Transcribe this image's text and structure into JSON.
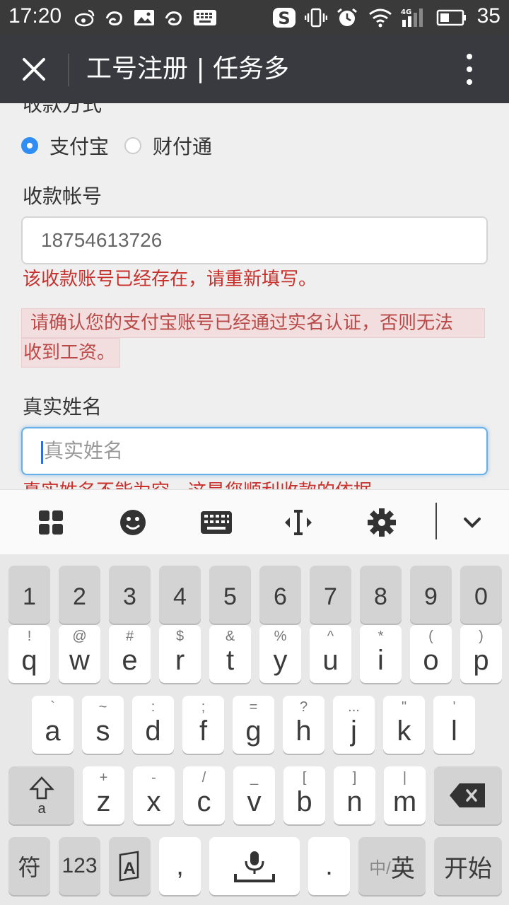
{
  "status_bar": {
    "time": "17:20",
    "battery": "35"
  },
  "title_bar": {
    "title": "工号注册 | 任务多"
  },
  "form": {
    "cut_label": "收款方式",
    "payment_options": [
      {
        "label": "支付宝",
        "checked": true
      },
      {
        "label": "财付通",
        "checked": false
      }
    ],
    "account_label": "收款帐号",
    "account_value": "18754613726",
    "account_error": "该收款账号已经存在，请重新填写。",
    "alert_line1": "请确认您的支付宝账号已经通过实名认证，否则无法",
    "alert_line2": "收到工资。",
    "name_label": "真实姓名",
    "name_placeholder": "真实姓名",
    "name_error": "真实姓名不能为空，这是您顺利收款的依据"
  },
  "keyboard": {
    "numbers": [
      "1",
      "2",
      "3",
      "4",
      "5",
      "6",
      "7",
      "8",
      "9",
      "0"
    ],
    "row1": [
      {
        "k": "q",
        "s": "!"
      },
      {
        "k": "w",
        "s": "@"
      },
      {
        "k": "e",
        "s": "#"
      },
      {
        "k": "r",
        "s": "$"
      },
      {
        "k": "t",
        "s": "&"
      },
      {
        "k": "y",
        "s": "%"
      },
      {
        "k": "u",
        "s": "^"
      },
      {
        "k": "i",
        "s": "*"
      },
      {
        "k": "o",
        "s": "("
      },
      {
        "k": "p",
        "s": ")"
      }
    ],
    "row2": [
      {
        "k": "a",
        "s": "`"
      },
      {
        "k": "s",
        "s": "~"
      },
      {
        "k": "d",
        "s": ":"
      },
      {
        "k": "f",
        "s": ";"
      },
      {
        "k": "g",
        "s": "="
      },
      {
        "k": "h",
        "s": "?"
      },
      {
        "k": "j",
        "s": "..."
      },
      {
        "k": "k",
        "s": "\""
      },
      {
        "k": "l",
        "s": "'"
      }
    ],
    "row3": [
      {
        "k": "z",
        "s": "+"
      },
      {
        "k": "x",
        "s": "-"
      },
      {
        "k": "c",
        "s": "/"
      },
      {
        "k": "v",
        "s": "_"
      },
      {
        "k": "b",
        "s": "["
      },
      {
        "k": "n",
        "s": "]"
      },
      {
        "k": "m",
        "s": "|"
      }
    ],
    "symbol_key": "符",
    "num_key": "123",
    "comma_key": ",",
    "period_key": ".",
    "lang_key_small": "中/",
    "lang_key_big": "英",
    "go_key": "开始"
  },
  "colors": {
    "accent": "#2f8df5",
    "error": "#c9302c",
    "titlebar": "#393a3f"
  }
}
